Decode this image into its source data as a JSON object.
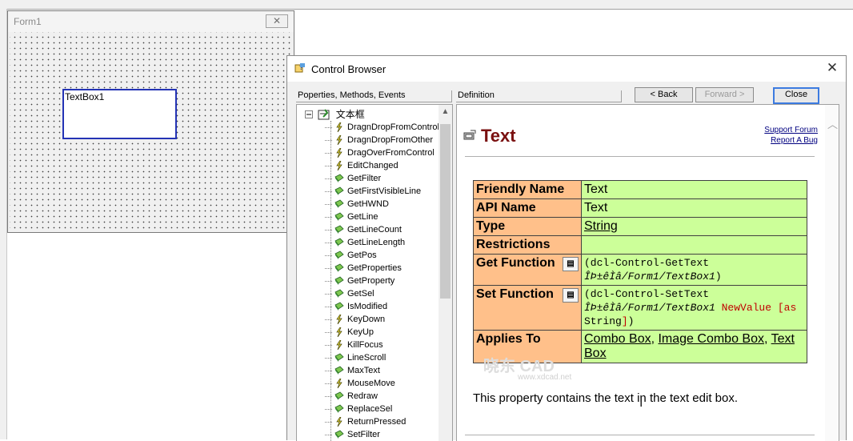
{
  "form_designer": {
    "title": "Form1",
    "close_glyph": "✕",
    "textbox_label": "TextBox1"
  },
  "control_browser": {
    "title": "Control Browser",
    "close_glyph": "✕",
    "headers": {
      "tree": "Poperties, Methods, Events",
      "definition": "Definition"
    },
    "buttons": {
      "back": "< Back",
      "forward": "Forward >",
      "close": "Close"
    },
    "tree": {
      "root_label": "文本框",
      "items": [
        {
          "label": "DragnDropFromControl",
          "icon": "event-icon"
        },
        {
          "label": "DragnDropFromOther",
          "icon": "event-icon"
        },
        {
          "label": "DragOverFromControl",
          "icon": "event-icon"
        },
        {
          "label": "EditChanged",
          "icon": "event-icon"
        },
        {
          "label": "GetFilter",
          "icon": "method-icon"
        },
        {
          "label": "GetFirstVisibleLine",
          "icon": "method-icon"
        },
        {
          "label": "GetHWND",
          "icon": "method-icon"
        },
        {
          "label": "GetLine",
          "icon": "method-icon"
        },
        {
          "label": "GetLineCount",
          "icon": "method-icon"
        },
        {
          "label": "GetLineLength",
          "icon": "method-icon"
        },
        {
          "label": "GetPos",
          "icon": "method-icon"
        },
        {
          "label": "GetProperties",
          "icon": "method-icon"
        },
        {
          "label": "GetProperty",
          "icon": "method-icon"
        },
        {
          "label": "GetSel",
          "icon": "method-icon"
        },
        {
          "label": "IsModified",
          "icon": "method-icon"
        },
        {
          "label": "KeyDown",
          "icon": "event-icon"
        },
        {
          "label": "KeyUp",
          "icon": "event-icon"
        },
        {
          "label": "KillFocus",
          "icon": "event-icon"
        },
        {
          "label": "LineScroll",
          "icon": "method-icon"
        },
        {
          "label": "MaxText",
          "icon": "method-icon"
        },
        {
          "label": "MouseMove",
          "icon": "event-icon"
        },
        {
          "label": "Redraw",
          "icon": "method-icon"
        },
        {
          "label": "ReplaceSel",
          "icon": "method-icon"
        },
        {
          "label": "ReturnPressed",
          "icon": "event-icon"
        },
        {
          "label": "SetFilter",
          "icon": "method-icon"
        }
      ]
    },
    "definition": {
      "title": "Text",
      "links": {
        "support": "Support Forum",
        "bug": "Report A Bug"
      },
      "rows": {
        "friendly_name": {
          "key": "Friendly Name",
          "value": "Text"
        },
        "api_name": {
          "key": "API Name",
          "value": "Text"
        },
        "type": {
          "key": "Type",
          "value": "String"
        },
        "restrictions": {
          "key": "Restrictions",
          "value": ""
        },
        "get_function": {
          "key": "Get Function",
          "line1": "(dcl-Control-GetText",
          "path": "ÎÞ±êÌâ/Form1/TextBox1",
          "close": ")"
        },
        "set_function": {
          "key": "Set Function",
          "line1": "(dcl-Control-SetText",
          "path": "ÎÞ±êÌâ/Form1/TextBox1",
          "param": " NewValue [as",
          "type": "String",
          "close_red": "]",
          "close": ")"
        },
        "applies_to": {
          "key": "Applies To",
          "items": [
            "Combo Box",
            "Image Combo Box",
            "Text Box"
          ],
          "sep": ", "
        }
      },
      "description": "This property contains the text in the text edit box."
    }
  },
  "watermark": {
    "main": "晓东 CAD",
    "sub": "www.xdcad.net"
  }
}
